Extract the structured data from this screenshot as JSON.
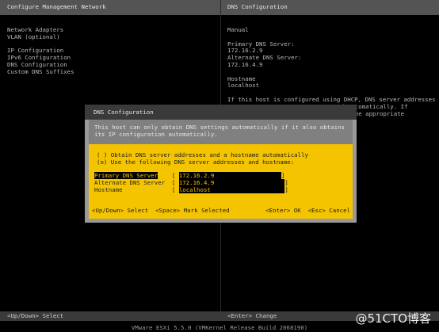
{
  "header": {
    "left_title": "Configure Management Network",
    "right_title": "DNS Configuration"
  },
  "menu": [
    {
      "label": "Network Adapters"
    },
    {
      "label": "VLAN (optional)"
    },
    {
      "label": ""
    },
    {
      "label": "IP Configuration"
    },
    {
      "label": "IPv6 Configuration"
    },
    {
      "label": "DNS Configuration"
    },
    {
      "label": "Custom DNS Suffixes"
    }
  ],
  "right_panel": {
    "mode": "Manual",
    "primary_label": "Primary DNS Server:",
    "primary_value": "172.16.2.9",
    "alternate_label": "Alternate DNS Server:",
    "alternate_value": "172.16.4.9",
    "hostname_label": "Hostname",
    "hostname_value": "localhost",
    "info_line1": "If this host is configured using DHCP, DNS server addresses",
    "info_line2_tail": "d automatically. If",
    "info_line3_tail": "or the appropriate"
  },
  "dialog": {
    "title": "DNS Configuration",
    "info_line1": "This host can only obtain DNS settings automatically if it also obtains",
    "info_line2": "its IP configuration automatically.",
    "option_auto": "( ) Obtain DNS server addresses and a hostname automatically",
    "option_manual": "(o) Use the following DNS server addresses and hostname:",
    "fields": {
      "primary": {
        "label": "Primary DNS Server",
        "value": "172.16.2.9"
      },
      "alternate": {
        "label": "Alternate DNS Server",
        "value": "172.16.4.9"
      },
      "hostname": {
        "label": "Hostname",
        "value": "localhost"
      }
    },
    "footer": {
      "updown_key": "<Up/Down>",
      "updown_text": "Select",
      "space_key": "<Space>",
      "space_text": "Mark Selected",
      "enter_key": "<Enter>",
      "enter_text": "OK",
      "esc_key": "<Esc>",
      "esc_text": "Cancel"
    }
  },
  "footer": {
    "left": "<Up/Down> Select",
    "right": "<Enter> Change"
  },
  "status": "VMware ESXi 5.5.0 (VMKernel Release Build 2068190)",
  "watermark": "@51CTO博客",
  "colors": {
    "dialog_yellow": "#f5c400",
    "header_gray": "#545454",
    "background": "#000000"
  }
}
